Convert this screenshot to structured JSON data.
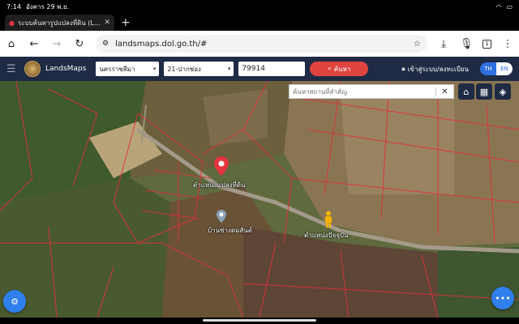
{
  "status": {
    "time": "7:14",
    "date": "อังคาร 29 พ.ย.",
    "battery_icon": "battery-icon",
    "wifi_icon": "wifi-icon"
  },
  "tab": {
    "title": "ระบบค้นหารูปแปลงที่ดิน (Lan",
    "close": "✕",
    "new_tab": "+"
  },
  "toolbar": {
    "url": "landsmaps.dol.go.th/#",
    "tab_count": "1"
  },
  "app": {
    "brand": "LandsMaps",
    "province": "นครราชสีมา",
    "district": "21-ปากช่อง",
    "parcel_no": "79914",
    "search_label": "ค้นหา",
    "login_label": "เข้าสู่ระบบ/ลงทะเบียน",
    "lang_th": "TH",
    "lang_en": "EN"
  },
  "map": {
    "place_search_placeholder": "ค้นหาสถานที่สำคัญ",
    "clear": "✕",
    "parcel_label": "ตำแหน่งแปลงที่ดิน",
    "house_label": "บ้านช่างคมสันต์",
    "current_location_label": "ตำแหน่งปัจจุบัน",
    "marker_color": "#e5343f",
    "accent_color": "#2f80ed"
  }
}
